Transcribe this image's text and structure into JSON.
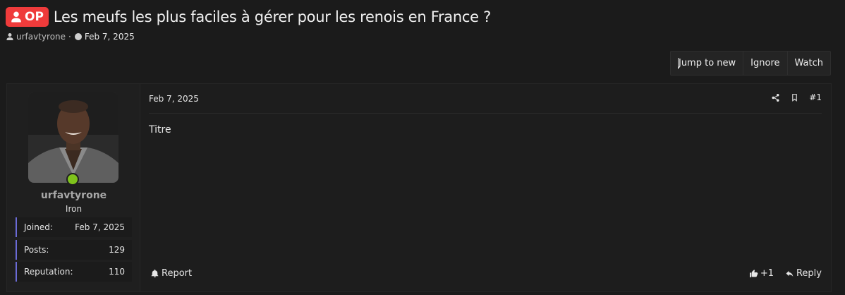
{
  "thread": {
    "badge": "OP",
    "title": "Les meufs les plus faciles à gérer pour les renois en France ?",
    "author": "urfavtyrone",
    "date": "Feb 7, 2025"
  },
  "toolbar": {
    "jump_to_new": "Jump to new",
    "ignore": "Ignore",
    "watch": "Watch"
  },
  "user": {
    "name": "urfavtyrone",
    "rank": "Iron",
    "stats": [
      {
        "label": "Joined:",
        "value": "Feb 7, 2025"
      },
      {
        "label": "Posts:",
        "value": "129"
      },
      {
        "label": "Reputation:",
        "value": "110"
      }
    ],
    "online_color": "#7fc31c"
  },
  "post": {
    "date": "Feb 7, 2025",
    "number": "#1",
    "body": "Titre",
    "report": "Report",
    "like_count": "+1",
    "reply": "Reply"
  },
  "colors": {
    "op_badge": "#ef3b3b",
    "stat_accent": "#6b6bd6",
    "background": "#1b1b1b"
  },
  "icons": [
    "user-icon",
    "clock-icon",
    "share-icon",
    "bookmark-icon",
    "bell-icon",
    "thumbs-up-icon",
    "reply-icon"
  ]
}
